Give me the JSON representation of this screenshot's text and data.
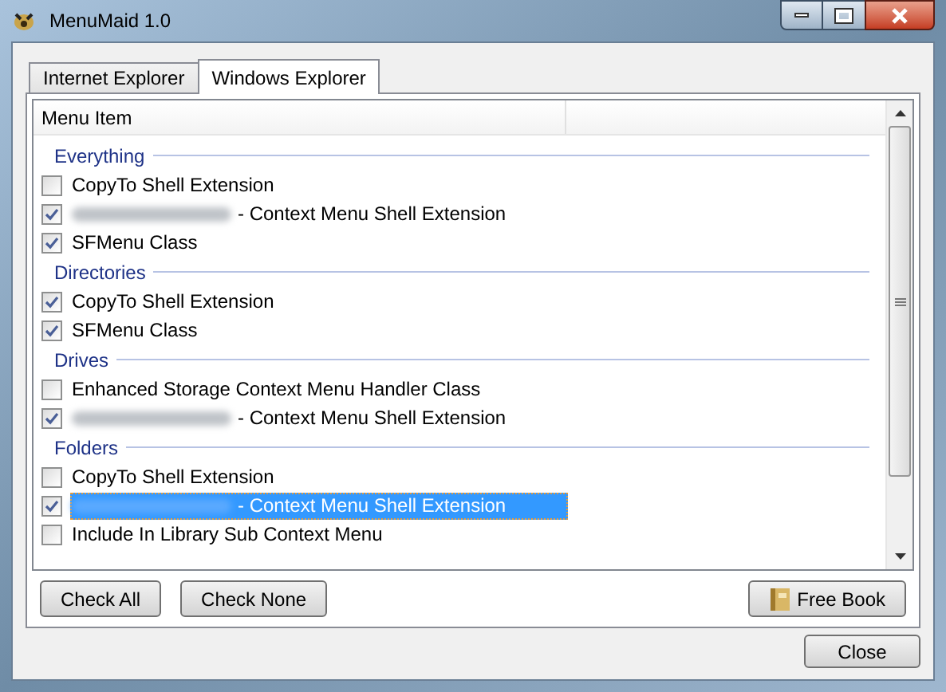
{
  "window": {
    "title": "MenuMaid 1.0"
  },
  "tabs": [
    {
      "label": "Internet Explorer",
      "selected": false
    },
    {
      "label": "Windows Explorer",
      "selected": true
    }
  ],
  "list": {
    "columns": [
      "Menu Item"
    ],
    "groups": [
      {
        "title": "Everything",
        "items": [
          {
            "label": "CopyTo Shell Extension",
            "checked": false,
            "redacted": false,
            "selected": false
          },
          {
            "label": "- Context Menu Shell Extension",
            "checked": true,
            "redacted": true,
            "selected": false
          },
          {
            "label": "SFMenu Class",
            "checked": true,
            "redacted": false,
            "selected": false
          }
        ]
      },
      {
        "title": "Directories",
        "items": [
          {
            "label": "CopyTo Shell Extension",
            "checked": true,
            "redacted": false,
            "selected": false
          },
          {
            "label": "SFMenu Class",
            "checked": true,
            "redacted": false,
            "selected": false
          }
        ]
      },
      {
        "title": "Drives",
        "items": [
          {
            "label": "Enhanced Storage Context Menu Handler Class",
            "checked": false,
            "redacted": false,
            "selected": false
          },
          {
            "label": "- Context Menu Shell Extension",
            "checked": true,
            "redacted": true,
            "selected": false
          }
        ]
      },
      {
        "title": "Folders",
        "items": [
          {
            "label": "CopyTo Shell Extension",
            "checked": false,
            "redacted": false,
            "selected": false
          },
          {
            "label": "- Context Menu Shell Extension",
            "checked": true,
            "redacted": true,
            "selected": true
          },
          {
            "label": "Include In Library Sub Context Menu",
            "checked": false,
            "redacted": false,
            "selected": false
          }
        ]
      }
    ]
  },
  "buttons": [
    {
      "label": "Check All",
      "kind": "plain"
    },
    {
      "label": "Check None",
      "kind": "plain"
    },
    {
      "label": "Free Book",
      "kind": "book"
    }
  ],
  "close_button": "Close"
}
